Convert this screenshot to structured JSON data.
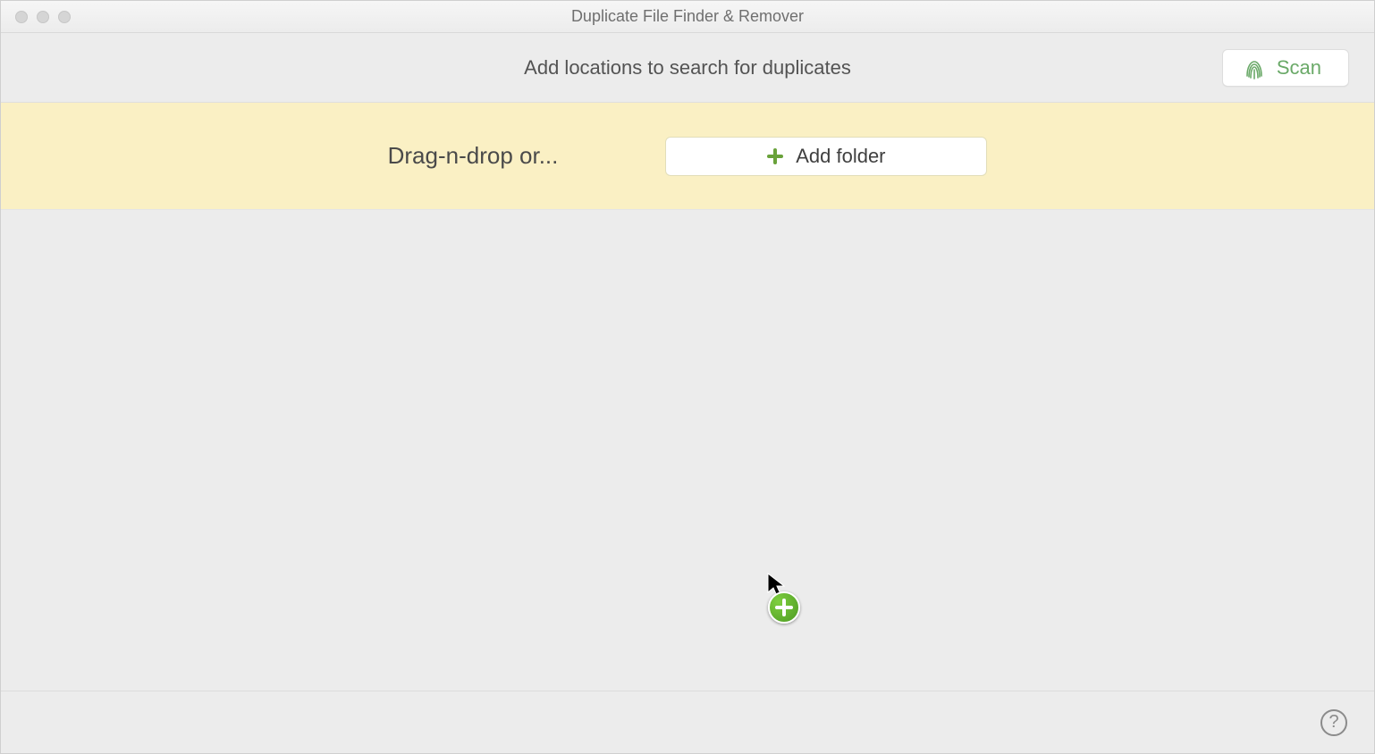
{
  "window": {
    "title": "Duplicate File Finder & Remover"
  },
  "toolbar": {
    "instruction": "Add locations to search for duplicates",
    "scan_label": "Scan"
  },
  "drop": {
    "drag_text": "Drag-n-drop or...",
    "add_folder_label": "Add folder"
  },
  "footer": {
    "help_label": "?"
  }
}
